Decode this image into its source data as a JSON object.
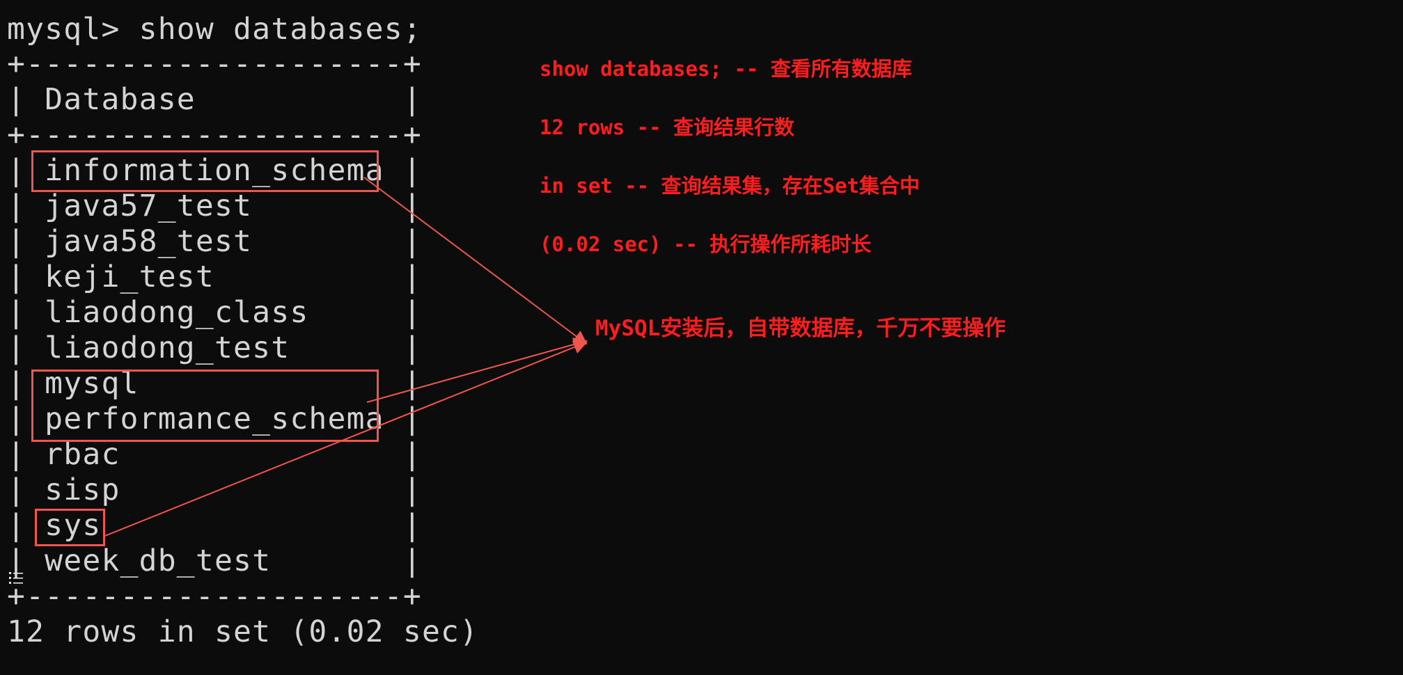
{
  "terminal": {
    "command_line": "mysql> show databases;",
    "border_line": "+--------------------+",
    "header_row": "| Database           |",
    "rows": [
      "| information_schema |",
      "| java57_test        |",
      "| java58_test        |",
      "| keji_test          |",
      "| liaodong_class     |",
      "| liaodong_test      |",
      "| mysql              |",
      "| performance_schema |",
      "| rbac               |",
      "| sisp               |",
      "| sys                |",
      "| week_db_test       |"
    ],
    "result_summary": "12 rows in set (0.02 sec)"
  },
  "annotations": {
    "notes": [
      "show databases; -- 查看所有数据库",
      "12 rows -- 查询结果行数",
      "in set -- 查询结果集，存在Set集合中",
      "(0.02 sec) -- 执行操作所耗时长"
    ],
    "system_db_callout": "MySQL安装后，自带数据库，千万不要操作"
  },
  "colors": {
    "background": "#0c0c0c",
    "terminal_text": "#d4d4d4",
    "annotation_text": "#ff1d1d",
    "highlight_box": "#f0574c"
  },
  "icons": {
    "list": "list-icon"
  }
}
